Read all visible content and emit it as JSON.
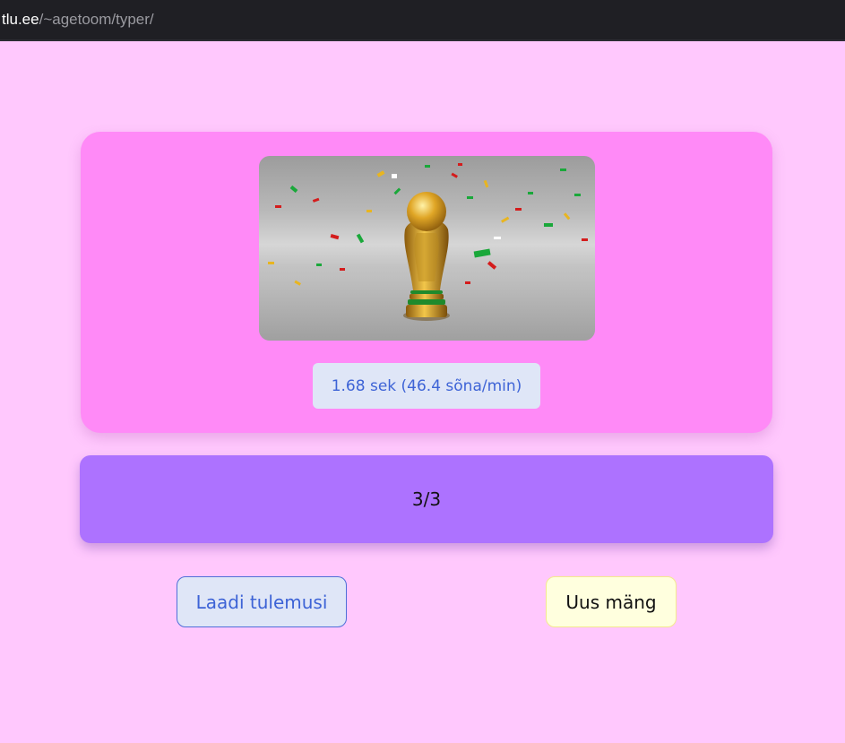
{
  "browser": {
    "url_host": "tlu.ee",
    "url_path": "/~agetoom/typer/"
  },
  "result": {
    "image_icon": "world-cup-trophy-with-confetti",
    "time_text": "1.68 sek (46.4 sõna/min)"
  },
  "progress": {
    "text": "3/3"
  },
  "actions": {
    "load_results_label": "Laadi tulemusi",
    "new_game_label": "Uus mäng"
  },
  "colors": {
    "page_background": "#ffc8fd",
    "result_card": "#ff8af7",
    "progress_bar": "#ad72ff",
    "accent_blue": "#3d63d6",
    "new_game_button": "#ffffde"
  }
}
